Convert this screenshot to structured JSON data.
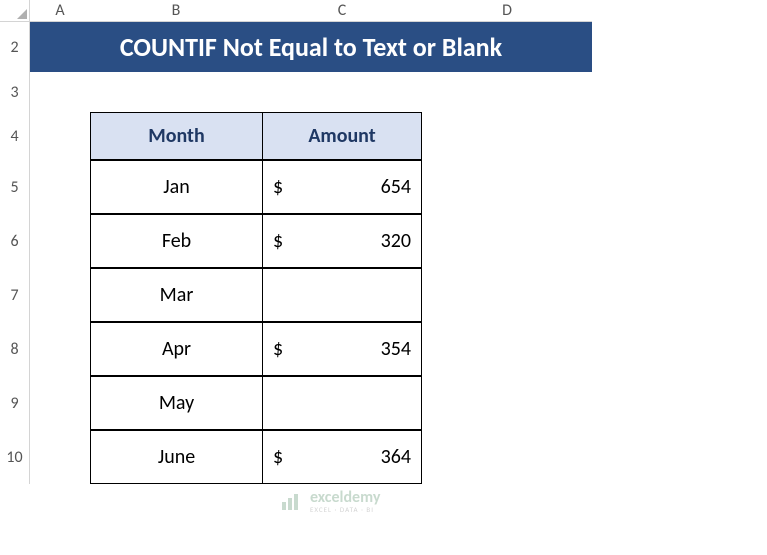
{
  "columns": [
    "A",
    "B",
    "C",
    "D"
  ],
  "rows": [
    "2",
    "3",
    "4",
    "5",
    "6",
    "7",
    "8",
    "9",
    "10"
  ],
  "title": "COUNTIF Not Equal to Text or Blank",
  "table": {
    "headers": {
      "month": "Month",
      "amount": "Amount"
    },
    "data": [
      {
        "month": "Jan",
        "currency": "$",
        "amount": "654"
      },
      {
        "month": "Feb",
        "currency": "$",
        "amount": "320"
      },
      {
        "month": "Mar",
        "currency": "",
        "amount": ""
      },
      {
        "month": "Apr",
        "currency": "$",
        "amount": "354"
      },
      {
        "month": "May",
        "currency": "",
        "amount": ""
      },
      {
        "month": "June",
        "currency": "$",
        "amount": "364"
      }
    ]
  },
  "watermark": {
    "main": "exceldemy",
    "sub": "EXCEL · DATA · BI"
  },
  "chart_data": {
    "type": "table",
    "title": "COUNTIF Not Equal to Text or Blank",
    "columns": [
      "Month",
      "Amount"
    ],
    "rows": [
      [
        "Jan",
        654
      ],
      [
        "Feb",
        320
      ],
      [
        "Mar",
        null
      ],
      [
        "Apr",
        354
      ],
      [
        "May",
        null
      ],
      [
        "June",
        364
      ]
    ]
  }
}
